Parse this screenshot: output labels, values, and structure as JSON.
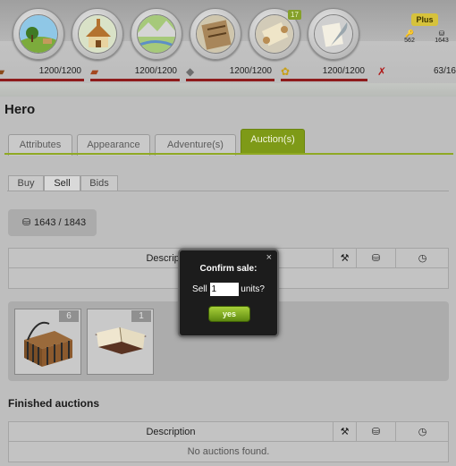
{
  "header": {
    "nav": [
      {
        "name": "village-overview",
        "icon": "meadow-icon"
      },
      {
        "name": "village-center",
        "icon": "town-hall-icon"
      },
      {
        "name": "map",
        "icon": "map-icon"
      },
      {
        "name": "statistics",
        "icon": "board-icon"
      },
      {
        "name": "reports",
        "icon": "scroll-icon",
        "badge": "17"
      },
      {
        "name": "messages",
        "icon": "quill-icon"
      }
    ],
    "plus_label": "Plus",
    "gold": "562",
    "silver": "1643",
    "resources": [
      {
        "name": "wood",
        "icon": "wood-icon",
        "value": "1200/1200"
      },
      {
        "name": "clay",
        "icon": "clay-icon",
        "value": "1200/1200"
      },
      {
        "name": "iron",
        "icon": "iron-icon",
        "value": "1200/1200"
      },
      {
        "name": "crop",
        "icon": "crop-icon",
        "value": "1200/1200"
      },
      {
        "name": "crop-consumption",
        "icon": "crop-consumption-icon",
        "value": "63/16"
      }
    ]
  },
  "page": {
    "title": "Hero",
    "tabs": [
      "Attributes",
      "Appearance",
      "Adventure(s)",
      "Auction(s)"
    ],
    "active_tab": "Auction(s)",
    "subtabs": [
      "Buy",
      "Sell",
      "Bids"
    ],
    "active_subtab": "Sell",
    "silver_balance": "1643 / 1843"
  },
  "sell_table": {
    "columns": [
      "Description"
    ],
    "empty_text": "No auctions found."
  },
  "inventory": [
    {
      "name": "cage",
      "count": "6"
    },
    {
      "name": "book",
      "count": "1"
    }
  ],
  "finished": {
    "title": "Finished auctions",
    "columns": [
      "Description"
    ],
    "empty_text": "No auctions found."
  },
  "dialog": {
    "title": "Confirm sale:",
    "sell_label": "Sell",
    "quantity": "1",
    "units_label": "units?",
    "confirm_label": "yes",
    "close_label": "×"
  }
}
